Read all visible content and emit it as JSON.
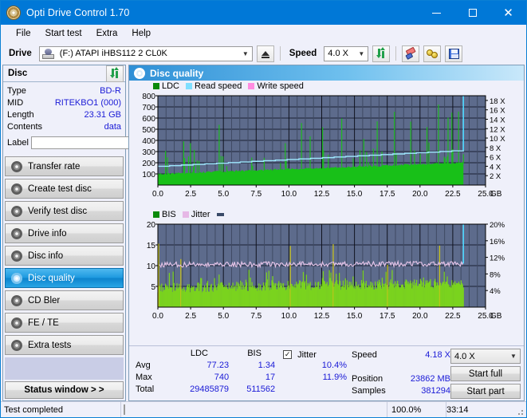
{
  "window": {
    "title": "Opti Drive Control 1.70",
    "icon": "disc-icon",
    "minimize": "–",
    "maximize": "☐",
    "close": "✕"
  },
  "menu": {
    "items": [
      "File",
      "Start test",
      "Extra",
      "Help"
    ]
  },
  "toolbar": {
    "drive_label": "Drive",
    "drive_value": "(F:)  ATAPI iHBS112  2 CL0K",
    "eject_title": "Eject",
    "speed_label": "Speed",
    "speed_value": "4.0 X",
    "icons": [
      "refresh-icon",
      "eraser-icon",
      "key-icon",
      "save-icon"
    ]
  },
  "disc_panel": {
    "title": "Disc",
    "refresh_icon": "refresh-icon",
    "rows": [
      {
        "key": "Type",
        "value": "BD-R"
      },
      {
        "key": "MID",
        "value": "RITEKBO1 (000)"
      },
      {
        "key": "Length",
        "value": "23.31 GB"
      },
      {
        "key": "Contents",
        "value": "data"
      }
    ],
    "label_key": "Label",
    "label_value": "",
    "label_placeholder": ""
  },
  "nav": {
    "items": [
      {
        "label": "Transfer rate",
        "selected": false
      },
      {
        "label": "Create test disc",
        "selected": false
      },
      {
        "label": "Verify test disc",
        "selected": false
      },
      {
        "label": "Drive info",
        "selected": false
      },
      {
        "label": "Disc info",
        "selected": false
      },
      {
        "label": "Disc quality",
        "selected": true
      },
      {
        "label": "CD Bler",
        "selected": false
      },
      {
        "label": "FE / TE",
        "selected": false
      },
      {
        "label": "Extra tests",
        "selected": false
      }
    ],
    "status_window": "Status window > >"
  },
  "content": {
    "header": "Disc quality",
    "header_icon": "disc-icon"
  },
  "stats": {
    "headers": [
      "LDC",
      "BIS"
    ],
    "row_labels": [
      "Avg",
      "Max",
      "Total"
    ],
    "ldc": [
      "77.23",
      "740",
      "29485879"
    ],
    "bis": [
      "1.34",
      "17",
      "511562"
    ],
    "jitter_label": "Jitter",
    "jitter_checked": true,
    "jitter_values": [
      "10.4%",
      "11.9%"
    ],
    "speed_label": "Speed",
    "speed_value": "4.18 X",
    "position_label": "Position",
    "position_value": "23862 MB",
    "samples_label": "Samples",
    "samples_value": "381294",
    "speed_select": "4.0 X",
    "start_full": "Start full",
    "start_part": "Start part"
  },
  "statusbar": {
    "message": "Test completed",
    "percent_text": "100.0%",
    "percent_value": 100,
    "elapsed": "33:14"
  },
  "colors": {
    "accent": "#0078d7",
    "ldc_green": "#18c018",
    "bis_green": "#7ad31e",
    "read_speed": "#7fdfff",
    "write_speed": "#ff8ce0",
    "jitter_pink": "#e6b8e6",
    "plot_bg": "#5d6b8c",
    "value_blue": "#1a1ad6",
    "progress_green": "#10a810"
  },
  "chart_data": [
    {
      "type": "line",
      "id": "ldc-chart",
      "title": "Disc quality",
      "xlabel": "GB",
      "ylabel": "",
      "xlim": [
        0,
        25.0
      ],
      "ylim": [
        0,
        800
      ],
      "xticks": [
        "0.0",
        "2.5",
        "5.0",
        "7.5",
        "10.0",
        "12.5",
        "15.0",
        "17.5",
        "20.0",
        "22.5",
        "25.0"
      ],
      "yticks": [
        "100",
        "200",
        "300",
        "400",
        "500",
        "600",
        "700",
        "800"
      ],
      "y2ticks": [
        "2 X",
        "4 X",
        "6 X",
        "8 X",
        "10 X",
        "12 X",
        "14 X",
        "16 X",
        "18 X"
      ],
      "y2lim": [
        0,
        19
      ],
      "x_unit_label": "GB",
      "grid": true,
      "legend_position": "top-left",
      "legend": [
        "LDC",
        "Read speed",
        "Write speed"
      ],
      "series": [
        {
          "name": "LDC",
          "color": "#18c018",
          "kind": "impulse-fill",
          "baseline_start": 105,
          "baseline_end": 200,
          "avg": 77.23,
          "max": 740
        },
        {
          "name": "Read speed",
          "color": "#7fdfff",
          "kind": "step-line",
          "start_x": 0.0,
          "end_x": 23.31,
          "start_value": 4.0,
          "end_value": 7.4
        },
        {
          "name": "Write speed",
          "color": "#ff8ce0",
          "kind": "line",
          "visible": false
        }
      ],
      "data_end_x": 23.31
    },
    {
      "type": "line",
      "id": "bis-chart",
      "xlabel": "GB",
      "xlim": [
        0,
        25.0
      ],
      "ylim": [
        0,
        20
      ],
      "xticks": [
        "0.0",
        "2.5",
        "5.0",
        "7.5",
        "10.0",
        "12.5",
        "15.0",
        "17.5",
        "20.0",
        "22.5",
        "25.0"
      ],
      "yticks": [
        "5",
        "10",
        "15",
        "20"
      ],
      "y2ticks": [
        "4%",
        "8%",
        "12%",
        "16%",
        "20%"
      ],
      "y2lim": [
        0,
        20
      ],
      "x_unit_label": "GB",
      "grid": true,
      "legend_position": "top-left",
      "legend": [
        "BIS",
        "Jitter"
      ],
      "series": [
        {
          "name": "BIS",
          "color": "#7ad31e",
          "kind": "impulse-fill",
          "baseline": 5.0,
          "avg": 1.34,
          "max": 17
        },
        {
          "name": "Jitter",
          "color": "#e6b8e6",
          "kind": "line",
          "avg_pct": 10.4,
          "max_pct": 11.9
        }
      ],
      "data_end_x": 23.31
    }
  ]
}
